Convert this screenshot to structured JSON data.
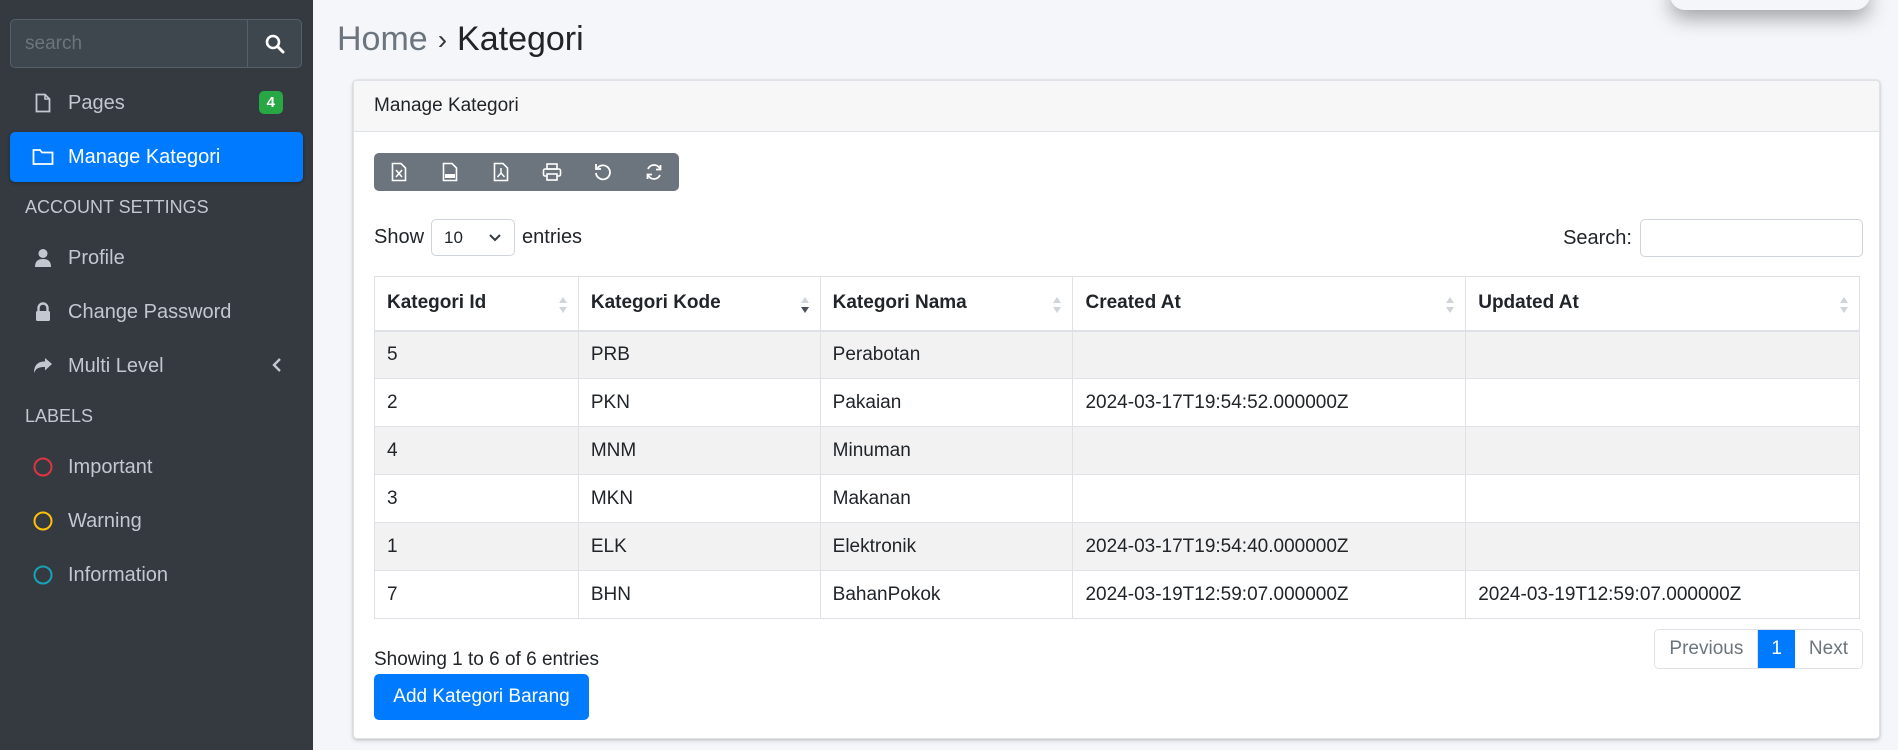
{
  "sidebar": {
    "search_placeholder": "search",
    "items": [
      {
        "label": "Pages",
        "badge": "4"
      },
      {
        "label": "Manage Kategori"
      }
    ],
    "account_header": "ACCOUNT SETTINGS",
    "account_items": [
      {
        "label": "Profile"
      },
      {
        "label": "Change Password"
      },
      {
        "label": "Multi Level"
      }
    ],
    "labels_header": "LABELS",
    "labels": [
      {
        "label": "Important",
        "color": "#dc3545"
      },
      {
        "label": "Warning",
        "color": "#ffc107"
      },
      {
        "label": "Information",
        "color": "#17a2b8"
      }
    ]
  },
  "breadcrumb": {
    "home": "Home",
    "separator": "›",
    "current": "Kategori"
  },
  "card": {
    "title": "Manage Kategori"
  },
  "export_buttons": [
    "excel-icon",
    "csv-icon",
    "pdf-icon",
    "print-icon",
    "undo-icon",
    "refresh-icon"
  ],
  "table_controls": {
    "show_label": "Show",
    "length_value": "10",
    "entries_label": "entries",
    "search_label": "Search:"
  },
  "table": {
    "columns": [
      "Kategori Id",
      "Kategori Kode",
      "Kategori Nama",
      "Created At",
      "Updated At"
    ],
    "rows": [
      [
        "5",
        "PRB",
        "Perabotan",
        "",
        ""
      ],
      [
        "2",
        "PKN",
        "Pakaian",
        "2024-03-17T19:54:52.000000Z",
        ""
      ],
      [
        "4",
        "MNM",
        "Minuman",
        "",
        ""
      ],
      [
        "3",
        "MKN",
        "Makanan",
        "",
        ""
      ],
      [
        "1",
        "ELK",
        "Elektronik",
        "2024-03-17T19:54:40.000000Z",
        ""
      ],
      [
        "7",
        "BHN",
        "BahanPokok",
        "2024-03-19T12:59:07.000000Z",
        "2024-03-19T12:59:07.000000Z"
      ]
    ]
  },
  "footer": {
    "info": "Showing 1 to 6 of 6 entries",
    "prev": "Previous",
    "page": "1",
    "next": "Next",
    "add_button": "Add Kategori Barang"
  },
  "colors": {
    "primary": "#007bff",
    "sidebar_bg": "#343a40",
    "badge": "#28a745"
  }
}
